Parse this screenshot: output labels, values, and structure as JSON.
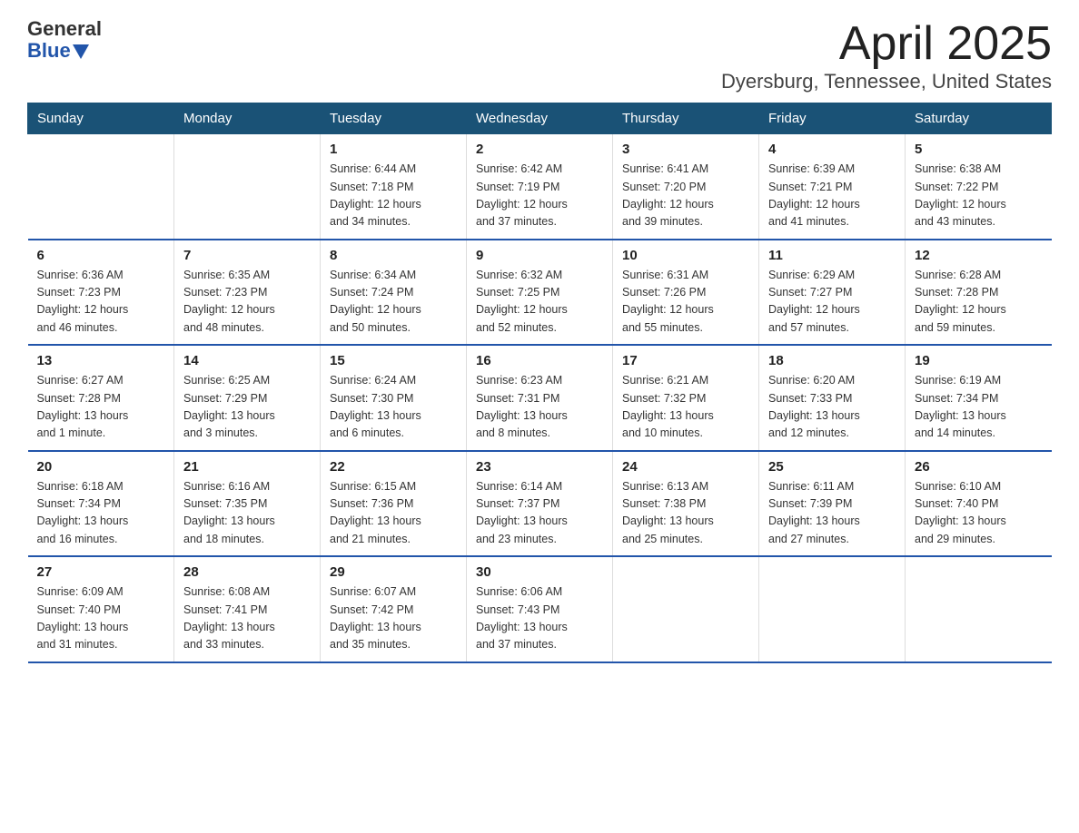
{
  "header": {
    "logo_general": "General",
    "logo_blue": "Blue",
    "title": "April 2025",
    "subtitle": "Dyersburg, Tennessee, United States"
  },
  "days_of_week": [
    "Sunday",
    "Monday",
    "Tuesday",
    "Wednesday",
    "Thursday",
    "Friday",
    "Saturday"
  ],
  "weeks": [
    [
      {
        "day": "",
        "info": ""
      },
      {
        "day": "",
        "info": ""
      },
      {
        "day": "1",
        "info": "Sunrise: 6:44 AM\nSunset: 7:18 PM\nDaylight: 12 hours\nand 34 minutes."
      },
      {
        "day": "2",
        "info": "Sunrise: 6:42 AM\nSunset: 7:19 PM\nDaylight: 12 hours\nand 37 minutes."
      },
      {
        "day": "3",
        "info": "Sunrise: 6:41 AM\nSunset: 7:20 PM\nDaylight: 12 hours\nand 39 minutes."
      },
      {
        "day": "4",
        "info": "Sunrise: 6:39 AM\nSunset: 7:21 PM\nDaylight: 12 hours\nand 41 minutes."
      },
      {
        "day": "5",
        "info": "Sunrise: 6:38 AM\nSunset: 7:22 PM\nDaylight: 12 hours\nand 43 minutes."
      }
    ],
    [
      {
        "day": "6",
        "info": "Sunrise: 6:36 AM\nSunset: 7:23 PM\nDaylight: 12 hours\nand 46 minutes."
      },
      {
        "day": "7",
        "info": "Sunrise: 6:35 AM\nSunset: 7:23 PM\nDaylight: 12 hours\nand 48 minutes."
      },
      {
        "day": "8",
        "info": "Sunrise: 6:34 AM\nSunset: 7:24 PM\nDaylight: 12 hours\nand 50 minutes."
      },
      {
        "day": "9",
        "info": "Sunrise: 6:32 AM\nSunset: 7:25 PM\nDaylight: 12 hours\nand 52 minutes."
      },
      {
        "day": "10",
        "info": "Sunrise: 6:31 AM\nSunset: 7:26 PM\nDaylight: 12 hours\nand 55 minutes."
      },
      {
        "day": "11",
        "info": "Sunrise: 6:29 AM\nSunset: 7:27 PM\nDaylight: 12 hours\nand 57 minutes."
      },
      {
        "day": "12",
        "info": "Sunrise: 6:28 AM\nSunset: 7:28 PM\nDaylight: 12 hours\nand 59 minutes."
      }
    ],
    [
      {
        "day": "13",
        "info": "Sunrise: 6:27 AM\nSunset: 7:28 PM\nDaylight: 13 hours\nand 1 minute."
      },
      {
        "day": "14",
        "info": "Sunrise: 6:25 AM\nSunset: 7:29 PM\nDaylight: 13 hours\nand 3 minutes."
      },
      {
        "day": "15",
        "info": "Sunrise: 6:24 AM\nSunset: 7:30 PM\nDaylight: 13 hours\nand 6 minutes."
      },
      {
        "day": "16",
        "info": "Sunrise: 6:23 AM\nSunset: 7:31 PM\nDaylight: 13 hours\nand 8 minutes."
      },
      {
        "day": "17",
        "info": "Sunrise: 6:21 AM\nSunset: 7:32 PM\nDaylight: 13 hours\nand 10 minutes."
      },
      {
        "day": "18",
        "info": "Sunrise: 6:20 AM\nSunset: 7:33 PM\nDaylight: 13 hours\nand 12 minutes."
      },
      {
        "day": "19",
        "info": "Sunrise: 6:19 AM\nSunset: 7:34 PM\nDaylight: 13 hours\nand 14 minutes."
      }
    ],
    [
      {
        "day": "20",
        "info": "Sunrise: 6:18 AM\nSunset: 7:34 PM\nDaylight: 13 hours\nand 16 minutes."
      },
      {
        "day": "21",
        "info": "Sunrise: 6:16 AM\nSunset: 7:35 PM\nDaylight: 13 hours\nand 18 minutes."
      },
      {
        "day": "22",
        "info": "Sunrise: 6:15 AM\nSunset: 7:36 PM\nDaylight: 13 hours\nand 21 minutes."
      },
      {
        "day": "23",
        "info": "Sunrise: 6:14 AM\nSunset: 7:37 PM\nDaylight: 13 hours\nand 23 minutes."
      },
      {
        "day": "24",
        "info": "Sunrise: 6:13 AM\nSunset: 7:38 PM\nDaylight: 13 hours\nand 25 minutes."
      },
      {
        "day": "25",
        "info": "Sunrise: 6:11 AM\nSunset: 7:39 PM\nDaylight: 13 hours\nand 27 minutes."
      },
      {
        "day": "26",
        "info": "Sunrise: 6:10 AM\nSunset: 7:40 PM\nDaylight: 13 hours\nand 29 minutes."
      }
    ],
    [
      {
        "day": "27",
        "info": "Sunrise: 6:09 AM\nSunset: 7:40 PM\nDaylight: 13 hours\nand 31 minutes."
      },
      {
        "day": "28",
        "info": "Sunrise: 6:08 AM\nSunset: 7:41 PM\nDaylight: 13 hours\nand 33 minutes."
      },
      {
        "day": "29",
        "info": "Sunrise: 6:07 AM\nSunset: 7:42 PM\nDaylight: 13 hours\nand 35 minutes."
      },
      {
        "day": "30",
        "info": "Sunrise: 6:06 AM\nSunset: 7:43 PM\nDaylight: 13 hours\nand 37 minutes."
      },
      {
        "day": "",
        "info": ""
      },
      {
        "day": "",
        "info": ""
      },
      {
        "day": "",
        "info": ""
      }
    ]
  ]
}
